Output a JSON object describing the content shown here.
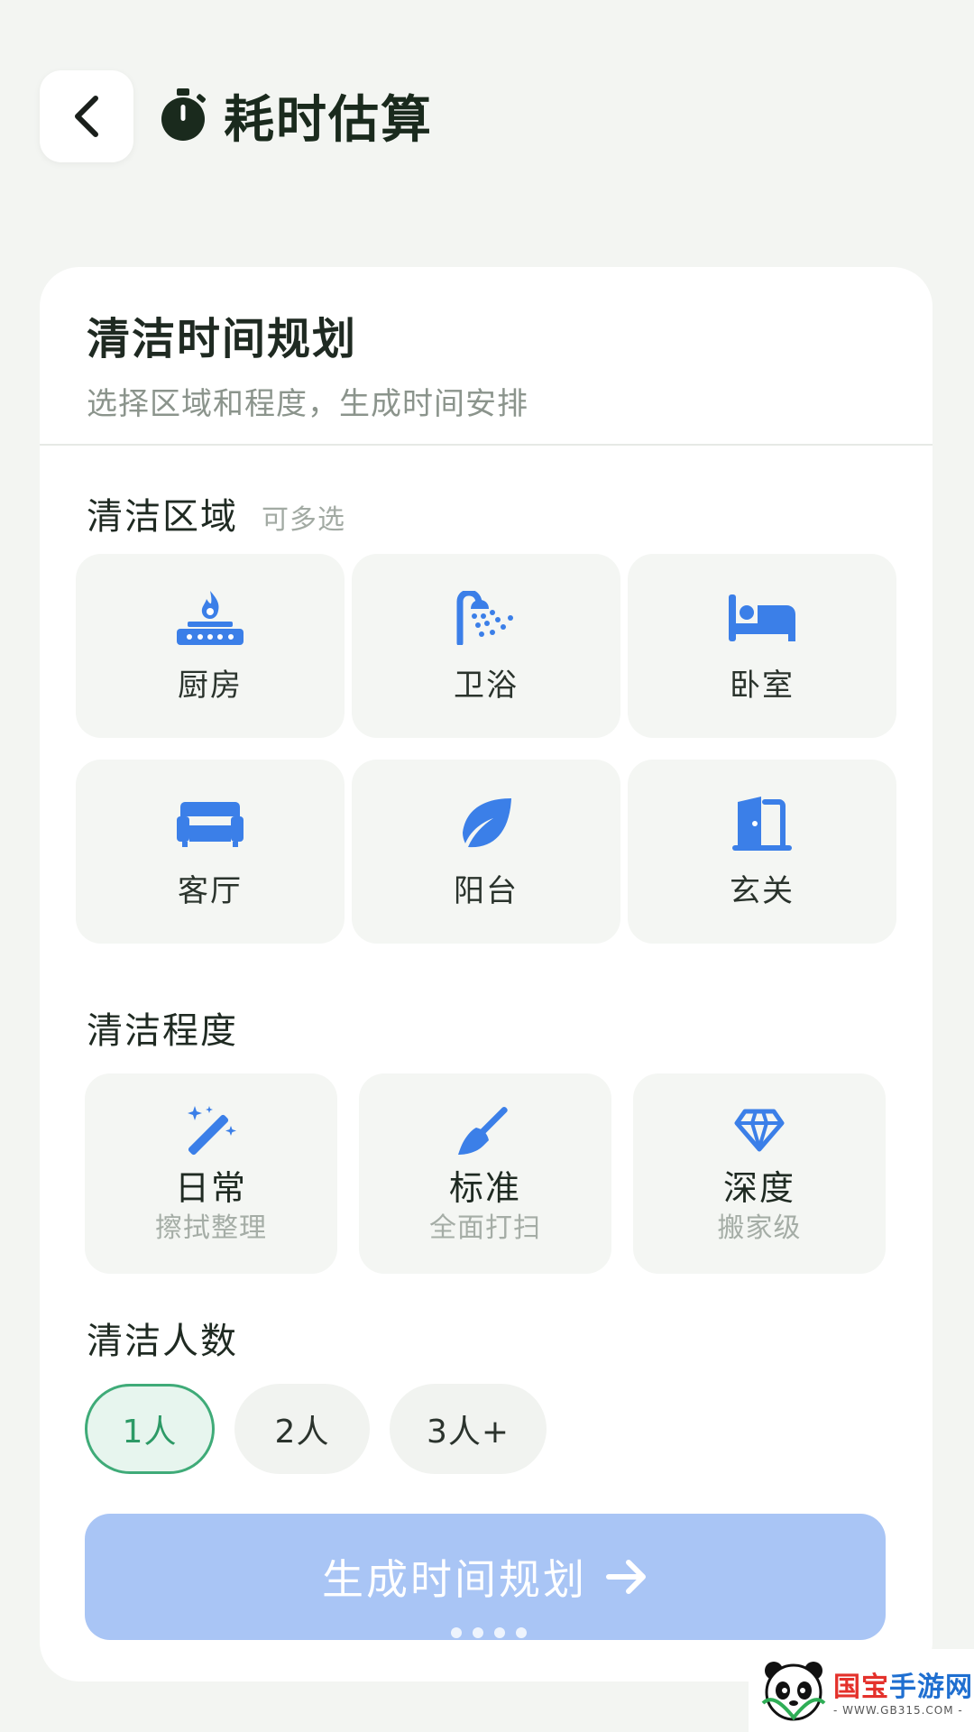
{
  "header": {
    "back_icon": "chevron-left-icon",
    "title_icon": "stopwatch-icon",
    "title": "耗时估算"
  },
  "card": {
    "title": "清洁时间规划",
    "subtitle": "选择区域和程度，生成时间安排"
  },
  "area_section": {
    "label": "清洁区域",
    "hint": "可多选",
    "items": [
      {
        "label": "厨房",
        "icon": "stove-icon"
      },
      {
        "label": "卫浴",
        "icon": "shower-icon"
      },
      {
        "label": "卧室",
        "icon": "bed-icon"
      },
      {
        "label": "客厅",
        "icon": "sofa-icon"
      },
      {
        "label": "阳台",
        "icon": "leaf-icon"
      },
      {
        "label": "玄关",
        "icon": "door-icon"
      }
    ]
  },
  "level_section": {
    "label": "清洁程度",
    "items": [
      {
        "name": "日常",
        "desc": "擦拭整理",
        "icon": "magic-wand-icon"
      },
      {
        "name": "标准",
        "desc": "全面打扫",
        "icon": "broom-icon"
      },
      {
        "name": "深度",
        "desc": "搬家级",
        "icon": "diamond-icon"
      }
    ]
  },
  "people_section": {
    "label": "清洁人数",
    "options": [
      "1人",
      "2人",
      "3人+"
    ],
    "selected": "1人"
  },
  "generate_button": {
    "label": "生成时间规划",
    "icon": "arrow-right-icon"
  },
  "colors": {
    "accent_blue": "#3b7fe8",
    "selected_green": "#3fab78",
    "button_disabled": "#a9c5f5"
  },
  "watermark": {
    "title_prefix": "国宝",
    "title_suffix": "手游网",
    "url": "- WWW.GB315.COM -"
  }
}
